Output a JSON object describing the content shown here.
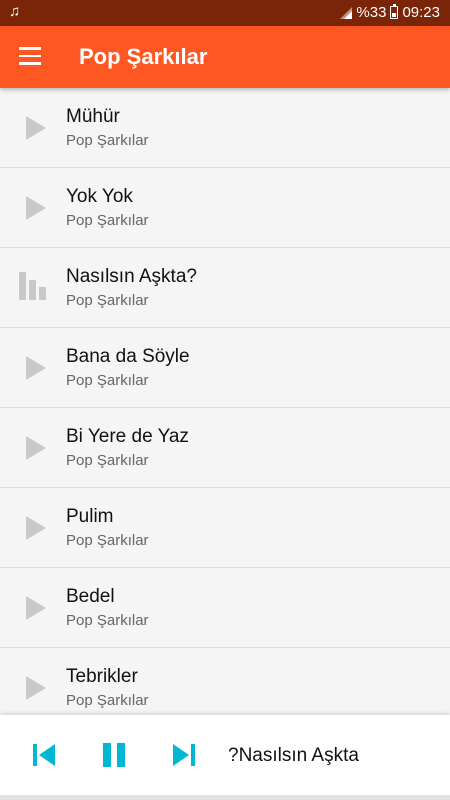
{
  "status_bar": {
    "music_icon": "music-note-icon",
    "battery": "%33",
    "time": "09:23"
  },
  "app_bar": {
    "title": "Pop Şarkılar",
    "menu_icon": "hamburger-menu-icon"
  },
  "songs": [
    {
      "title": "Mühür",
      "artist": "Pop Şarkılar",
      "icon": "play"
    },
    {
      "title": "Yok Yok",
      "artist": "Pop Şarkılar",
      "icon": "play"
    },
    {
      "title": "Nasılsın Aşkta?",
      "artist": "Pop Şarkılar",
      "icon": "equalizer"
    },
    {
      "title": "Bana da Söyle",
      "artist": "Pop Şarkılar",
      "icon": "play"
    },
    {
      "title": "Bi Yere de Yaz",
      "artist": "Pop Şarkılar",
      "icon": "play"
    },
    {
      "title": "Pulim",
      "artist": "Pop Şarkılar",
      "icon": "play"
    },
    {
      "title": "Bedel",
      "artist": "Pop Şarkılar",
      "icon": "play"
    },
    {
      "title": "Tebrikler",
      "artist": "Pop Şarkılar",
      "icon": "play"
    }
  ],
  "player": {
    "now_playing": "?Nasılsın Aşkta",
    "accent": "#00b8d4"
  },
  "colors": {
    "status_bar": "#7a2508",
    "app_bar": "#ff5722",
    "icon_gray": "#c8c8c8"
  }
}
